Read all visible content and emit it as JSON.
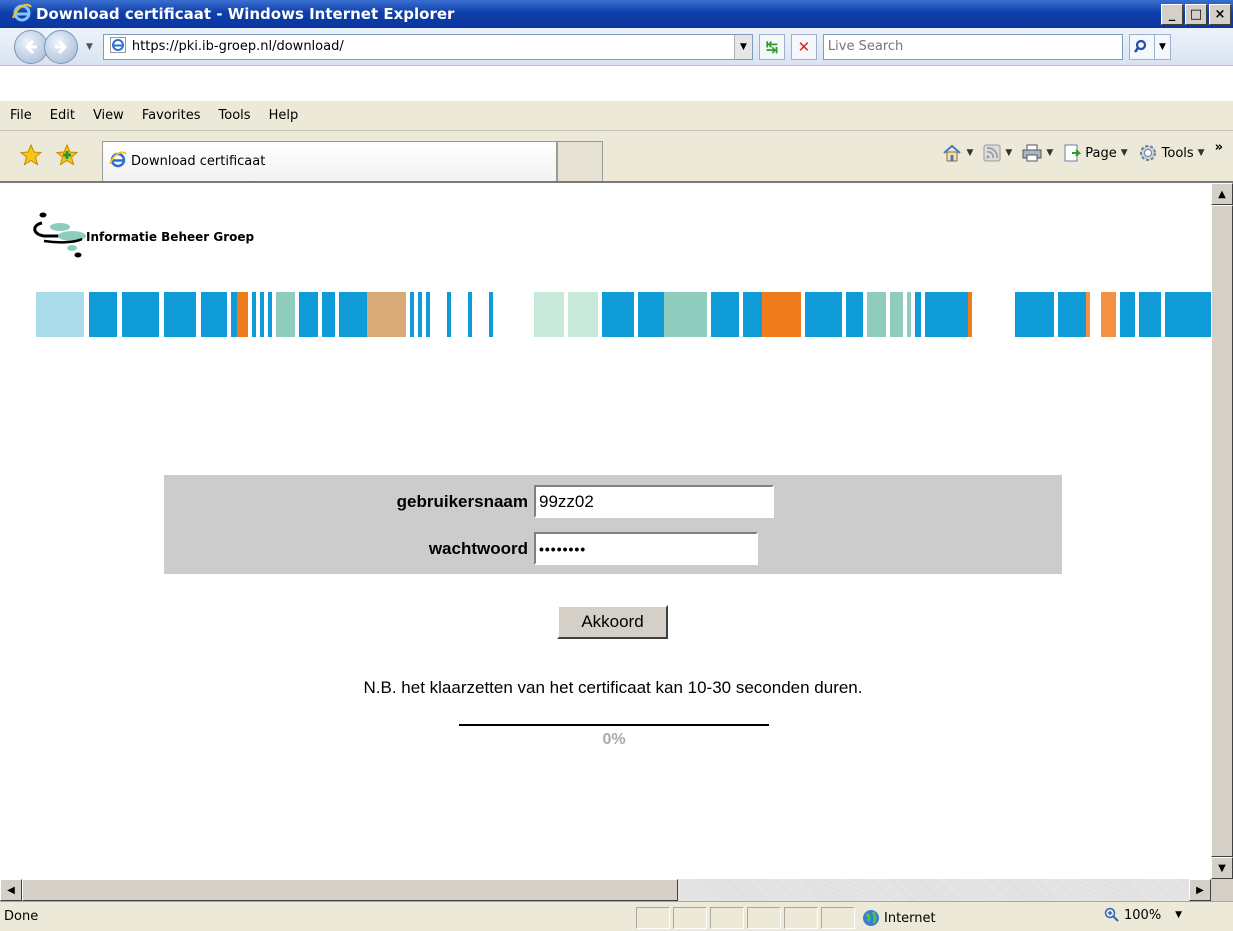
{
  "window": {
    "title": "Download certificaat - Windows Internet Explorer",
    "minimize": "_",
    "maximize": "□",
    "close": "×"
  },
  "address": {
    "url": "https://pki.ib-groep.nl/download/",
    "search_placeholder": "Live Search"
  },
  "menu": {
    "items": [
      "File",
      "Edit",
      "View",
      "Favorites",
      "Tools",
      "Help"
    ]
  },
  "favorites": {
    "tab_title": "Download certificaat",
    "page_label": "Page",
    "tools_label": "Tools",
    "overflow": "»"
  },
  "page": {
    "logo_text": "Informatie Beheer Groep",
    "username_label": "gebruikersnaam",
    "username_value": "99zz02",
    "password_label": "wachtwoord",
    "password_value": "••••••••",
    "submit_label": "Akkoord",
    "note": "N.B. het klaarzetten van het certificaat kan 10-30 seconden duren.",
    "progress_text": "0%",
    "progress_value": 0
  },
  "stripe_colors": [
    "#a9dbe8",
    "#fff",
    "#0e9bd8",
    "#fff",
    "#0e9bd8",
    "#fff",
    "#0e9bd8",
    "#fff",
    "#0e9bd8",
    "#fff",
    "#0e9bd8",
    "#ee7c1d",
    "#fff",
    "#0e9bd8",
    "#fff",
    "#0e9bd8",
    "#fff",
    "#0e9bd8",
    "#fff",
    "#8ecdbd",
    "#fff",
    "#0e9bd8",
    "#fff",
    "#0e9bd8",
    "#fff",
    "#0e9bd8",
    "#d8aa78",
    "#fff",
    "#0e9bd8",
    "#fff",
    "#0e9bd8",
    "#fff",
    "#0e9bd8",
    "#fff",
    "#0e9bd8",
    "#fff",
    "#0e9bd8",
    "#fff",
    "#0e9bd8",
    "#fff",
    "#c8e8da",
    "#fff",
    "#c8e8da",
    "#fff",
    "#0e9bd8",
    "#fff",
    "#0e9bd8",
    "#8ecdbd",
    "#fff",
    "#0e9bd8",
    "#fff",
    "#0e9bd8",
    "#ee7c1d",
    "#fff",
    "#0e9bd8",
    "#fff",
    "#0e9bd8",
    "#fff",
    "#8ecdbd",
    "#fff",
    "#8ecdbd",
    "#fff",
    "#8ecdbd",
    "#fff",
    "#0e9bd8",
    "#fff",
    "#0e9bd8",
    "#ee7c1d",
    "#fff",
    "#0e9bd8",
    "#fff",
    "#0e9bd8",
    "#f59040",
    "#fff",
    "#f59040",
    "#fff",
    "#0e9bd8",
    "#fff",
    "#0e9bd8",
    "#fff",
    "#0e9bd8"
  ],
  "stripe_widths": [
    44,
    5,
    26,
    5,
    34,
    5,
    30,
    5,
    24,
    4,
    6,
    10,
    4,
    4,
    4,
    4,
    4,
    4,
    4,
    18,
    4,
    18,
    4,
    12,
    4,
    26,
    36,
    4,
    4,
    4,
    4,
    4,
    4,
    16,
    4,
    16,
    4,
    16,
    4,
    38,
    28,
    4,
    28,
    4,
    30,
    4,
    24,
    40,
    4,
    26,
    4,
    18,
    36,
    4,
    34,
    4,
    16,
    4,
    18,
    4,
    12,
    4,
    4,
    4,
    6,
    4,
    40,
    4,
    40,
    36,
    4,
    26,
    4,
    10,
    14,
    4,
    14,
    4,
    20,
    4,
    24
  ],
  "status": {
    "text": "Done",
    "zone": "Internet",
    "zoom": "100%"
  },
  "colors": {
    "title_bar": "#0a36a0",
    "panel_bg": "#cccccc",
    "chrome": "#ece9d8"
  }
}
